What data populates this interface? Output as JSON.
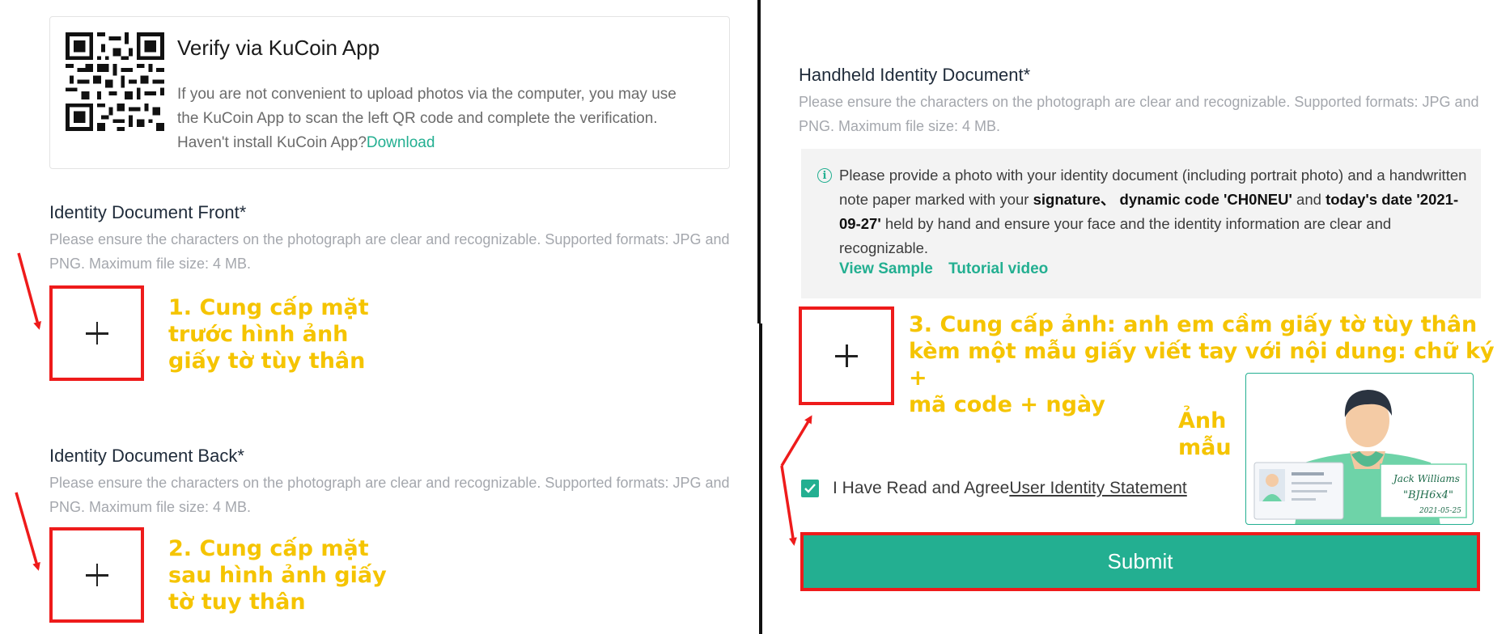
{
  "qr_card": {
    "title": "Verify via KuCoin App",
    "desc_line1": "If you are not convenient to upload photos via the computer, you may use",
    "desc_line2": "the KuCoin App to scan the left QR code and complete the verification.",
    "desc_line3": "Haven't install KuCoin App?",
    "download_link": "Download"
  },
  "front": {
    "label": "Identity Document Front*",
    "hint": "Please ensure the characters on the photograph are clear and recognizable. Supported formats: JPG and PNG. Maximum file size: 4 MB.",
    "annotation_l1": "1. Cung cấp mặt",
    "annotation_l2": "trước hình ảnh",
    "annotation_l3": "giấy tờ tùy thân"
  },
  "back": {
    "label": "Identity Document Back*",
    "hint": "Please ensure the characters on the photograph are clear and recognizable. Supported formats: JPG and PNG. Maximum file size: 4 MB.",
    "annotation_l1": "2. Cung cấp mặt",
    "annotation_l2": "sau hình ảnh giấy",
    "annotation_l3": "tờ tuy thân"
  },
  "handheld": {
    "label": "Handheld Identity Document*",
    "hint": "Please ensure the characters on the photograph are clear and recognizable. Supported formats: JPG and PNG. Maximum file size: 4 MB.",
    "note_p1": "Please provide a photo with your identity document (including portrait photo) and a handwritten note paper marked with your ",
    "note_b1": "signature、 dynamic code 'CH0NEU'",
    "note_p2": " and ",
    "note_b2": "today's date '2021-09-27'",
    "note_p3": " held by hand and ensure your face and the identity information are clear and recognizable.",
    "view_sample": "View Sample",
    "tutorial_video": "Tutorial video",
    "annotation_l1": "3. Cung cấp ảnh: anh em cầm giấy tờ tùy thân",
    "annotation_l2": "kèm một mẫu giấy viết tay với nội dung: chữ ký +",
    "annotation_l3": "mã code + ngày",
    "sample_label_l1": "Ảnh",
    "sample_label_l2": "mẫu",
    "sample_note_l1": "Jack Williams",
    "sample_note_l2": "\"BJH6x4\"",
    "sample_note_l3": "2021-05-25"
  },
  "agree": {
    "prefix": "I Have Read and Agree",
    "link": "User Identity Statement",
    "checked": true
  },
  "submit_label": "Submit",
  "colors": {
    "accent": "#23af91",
    "annotation": "#f5c400",
    "highlight_red": "#ee1b1b"
  }
}
